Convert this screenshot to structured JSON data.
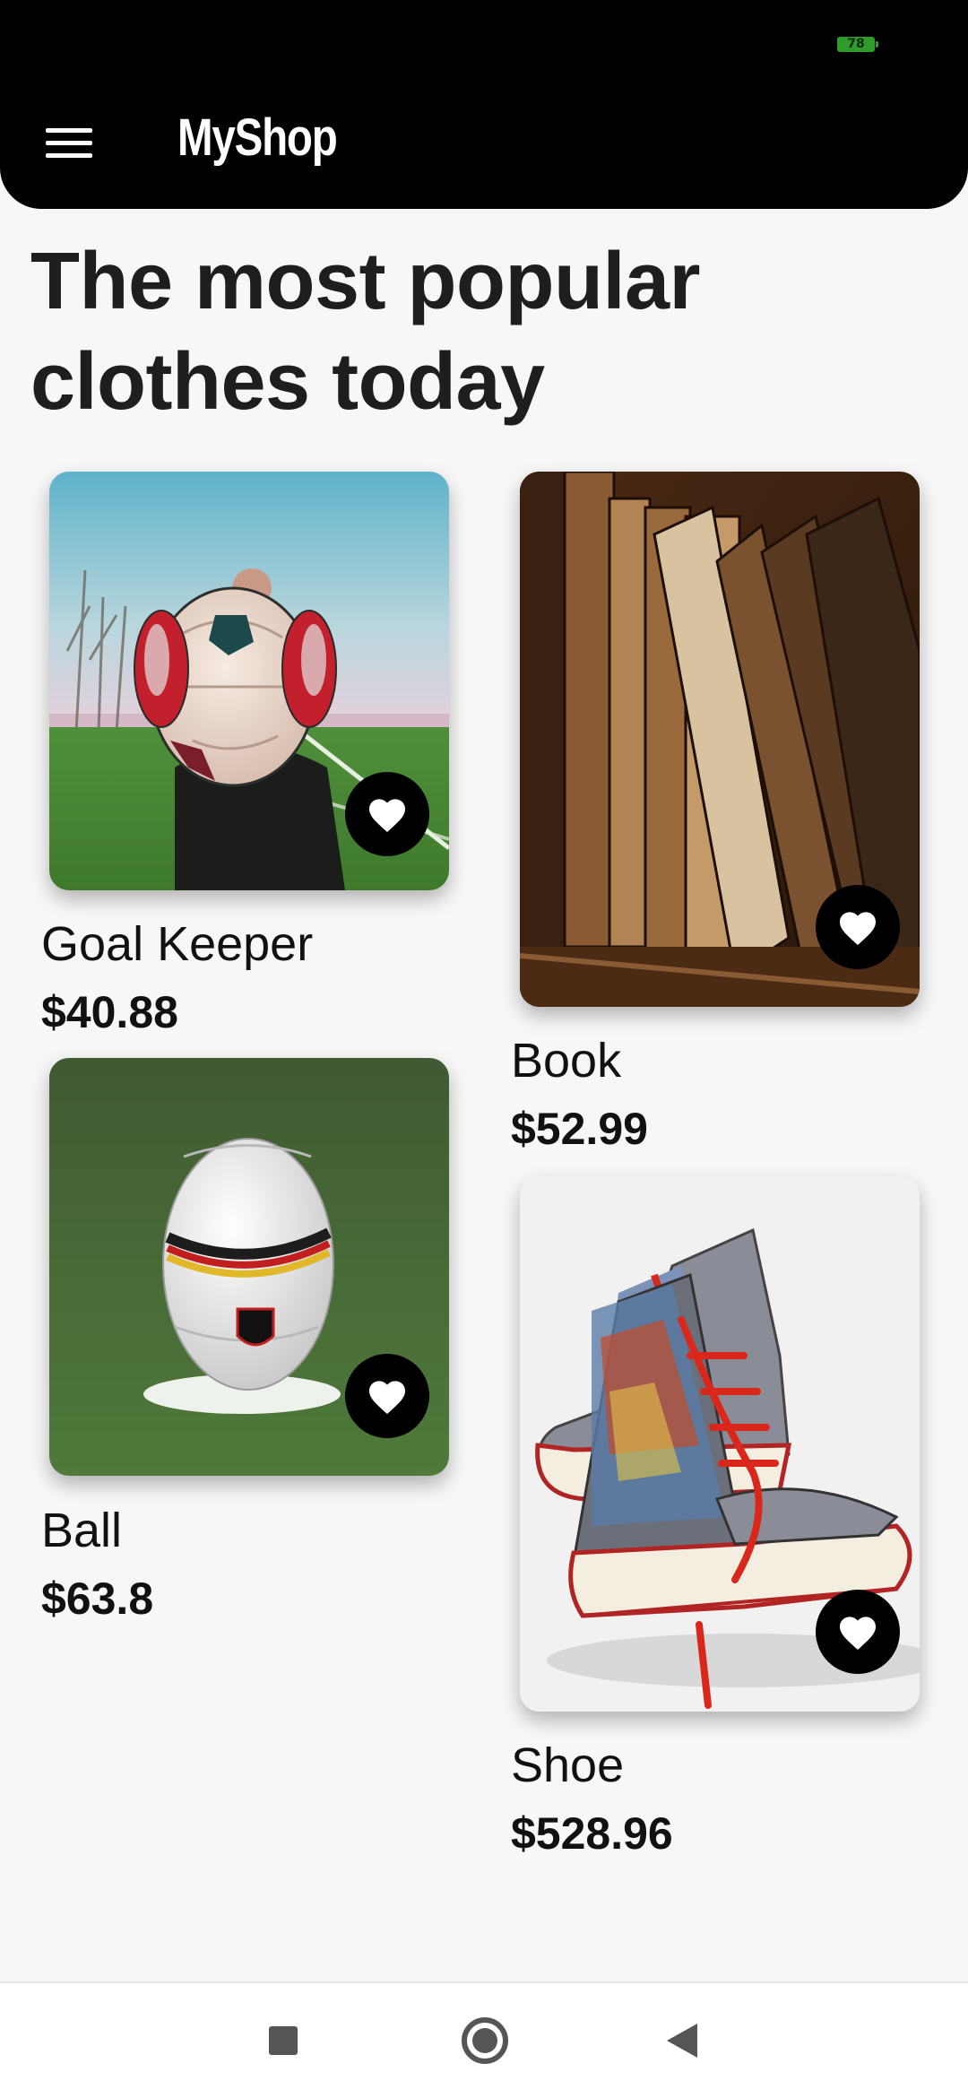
{
  "status_bar": {
    "battery": "78"
  },
  "app_bar": {
    "title": "MyShop",
    "menu_icon": "hamburger-menu-icon"
  },
  "headline": "The most popular clothes today",
  "products": [
    {
      "name": "Goal Keeper",
      "price": "$40.88",
      "image": "goalkeeper-holding-ball-photo",
      "favorite_icon": "heart-icon"
    },
    {
      "name": "Book",
      "price": "$52.99",
      "image": "old-books-on-shelf-photo",
      "favorite_icon": "heart-icon"
    },
    {
      "name": "Ball",
      "price": "$63.8",
      "image": "soccer-ball-on-grass-photo",
      "favorite_icon": "heart-icon"
    },
    {
      "name": "Shoe",
      "price": "$528.96",
      "image": "comic-print-sneakers-photo",
      "favorite_icon": "heart-icon"
    }
  ],
  "nav_bar": {
    "icons": [
      "recents-square-icon",
      "home-circle-icon",
      "back-triangle-icon"
    ]
  },
  "colors": {
    "app_bar": "#000000",
    "background": "#f7f7f7",
    "text": "#111111",
    "battery": "#2e9b2a"
  }
}
